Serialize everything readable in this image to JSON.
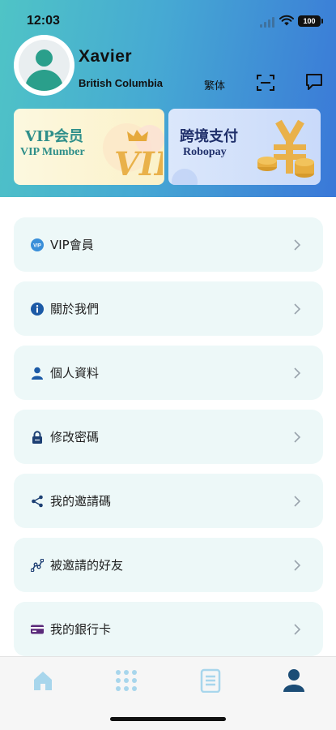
{
  "status_bar": {
    "time": "12:03",
    "battery": "100"
  },
  "profile": {
    "name": "Xavier",
    "location": "British Columbia",
    "language_toggle": "繁体"
  },
  "banners": {
    "vip": {
      "title": "VIP会员",
      "subtitle": "VIP Mumber",
      "art_text": "VIP"
    },
    "pay": {
      "title": "跨境支付",
      "subtitle": "Robopay"
    }
  },
  "menu": {
    "items": [
      {
        "label": "VIP會員",
        "icon": "vip-badge-icon"
      },
      {
        "label": "關於我們",
        "icon": "info-icon"
      },
      {
        "label": "個人資料",
        "icon": "user-icon"
      },
      {
        "label": "修改密碼",
        "icon": "lock-icon"
      },
      {
        "label": "我的邀請碼",
        "icon": "share-icon"
      },
      {
        "label": "被邀請的好友",
        "icon": "network-icon"
      },
      {
        "label": "我的銀行卡",
        "icon": "bank-card-icon"
      }
    ]
  },
  "tabbar": {
    "tabs": [
      {
        "icon": "home-icon",
        "active": false
      },
      {
        "icon": "grid-icon",
        "active": false
      },
      {
        "icon": "document-icon",
        "active": false
      },
      {
        "icon": "profile-icon",
        "active": true
      }
    ],
    "active_color": "#1c4d76",
    "inactive_color": "#a8d6ec"
  },
  "colors": {
    "header_gradient_start": "#4fc4c6",
    "header_gradient_end": "#3a78d8",
    "menu_item_bg": "#edf8f8",
    "icon_blue": "#1c5aa6"
  }
}
